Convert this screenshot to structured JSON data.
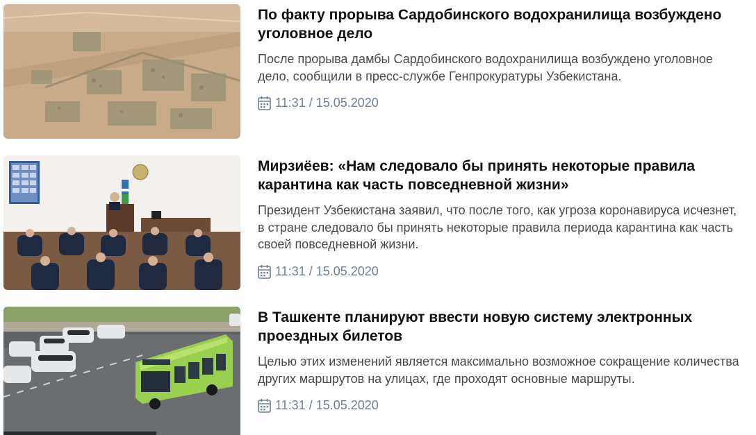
{
  "articles": [
    {
      "title": "По факту прорыва Сардобинского водохранилища возбуждено уголовное дело",
      "lead": "После прорыва дамбы Сардобинского водохранилища возбуждено уголовное дело, сообщили в пресс-службе Генпрокуратуры Узбекистана.",
      "datetime": "11:31 / 15.05.2020",
      "image": "flood-aerial-photo"
    },
    {
      "title": "Мирзиёев: «Нам следовало бы принять некоторые правила карантина как часть повседневной жизни»",
      "lead": "Президент Узбекистана заявил, что после того, как угроза коронавируса исчезнет, в стране следовало бы принять некоторые правила периода карантина как часть своей повседневной жизни.",
      "datetime": "11:31 / 15.05.2020",
      "image": "government-meeting-photo"
    },
    {
      "title": "В Ташкенте планируют ввести новую систему электронных проездных билетов",
      "lead": "Целью этих изменений является максимально возможное сокращение количества других маршрутов на улицах, где проходят основные маршруты.",
      "datetime": "11:31 / 15.05.2020",
      "image": "city-bus-photo"
    }
  ],
  "icons": {
    "date": "calendar-icon"
  },
  "colors": {
    "title": "#111111",
    "lead": "#4a4a4a",
    "meta": "#6b7e99"
  }
}
